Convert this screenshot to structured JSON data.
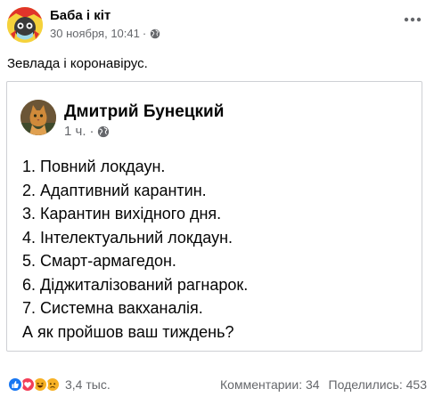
{
  "post": {
    "page_name": "Баба і кіт",
    "timestamp": "30 ноября, 10:41",
    "separator": "·",
    "text": "Зевлада і коронавірус."
  },
  "shared": {
    "author_name": "Дмитрий Бунецкий",
    "time": "1 ч.",
    "separator": "·",
    "items": [
      "1. Повний локдаун.",
      "2. Адаптивний карантин.",
      "3. Карантин вихідного дня.",
      "4. Інтелектуальний локдаун.",
      "5. Смарт-армагедон.",
      "6. Діджиталізований рагнарок.",
      "7. Системна вакханалія.",
      "А як пройшов ваш тиждень?"
    ]
  },
  "footer": {
    "reaction_icons": [
      "like-icon",
      "love-icon",
      "haha-icon",
      "sad-icon"
    ],
    "reaction_count": "3,4 тыс.",
    "comments": "Комментарии: 34",
    "shares": "Поделились: 453"
  },
  "colors": {
    "text": "#050505",
    "secondary_text": "#65676b",
    "border": "#ced0d4",
    "like_blue": "#1877f2",
    "love_red": "#f33e58",
    "reaction_yellow": "#f7b125"
  }
}
